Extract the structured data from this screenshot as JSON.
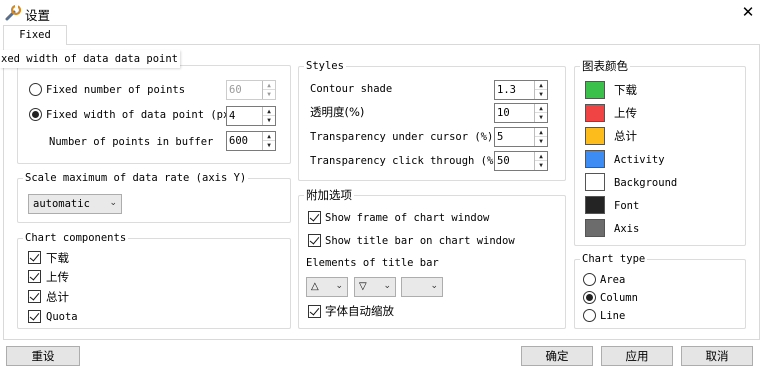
{
  "window": {
    "title": "设置"
  },
  "tabs": {
    "fixed": "Fixed"
  },
  "tooltip": "xed width of data data point",
  "points_group": {
    "fixed_number_label": "Fixed number of points",
    "fixed_number_value": "60",
    "fixed_width_label": "Fixed width of data point (px)",
    "fixed_width_value": "4",
    "buffer_label": "Number of points in buffer",
    "buffer_value": "600"
  },
  "scale_group": {
    "title": "Scale maximum of data rate (axis Y)",
    "value": "automatic"
  },
  "components_group": {
    "title": "Chart components",
    "items": [
      {
        "label": "下载",
        "checked": true
      },
      {
        "label": "上传",
        "checked": true
      },
      {
        "label": "总计",
        "checked": true
      },
      {
        "label": "Quota",
        "checked": true
      }
    ]
  },
  "styles_group": {
    "title": "Styles",
    "contour_label": "Contour shade",
    "contour_value": "1.3",
    "opacity_label": "透明度(%)",
    "opacity_value": "10",
    "cursor_label": "Transparency under cursor (%)",
    "cursor_value": "5",
    "click_label": "Transparency click through (%)",
    "click_value": "50"
  },
  "extra_group": {
    "title": "附加选项",
    "show_frame": "Show frame of chart window",
    "show_title": "Show title bar on chart window",
    "elements_label": "Elements of title bar",
    "auto_scale": "字体自动缩放",
    "combo1_icon": "triangle-up-outline",
    "combo2_icon": "triangle-down-outline"
  },
  "colors_group": {
    "title": "图表颜色",
    "items": [
      {
        "label": "下载",
        "color": "#3cc04c"
      },
      {
        "label": "上传",
        "color": "#f04444"
      },
      {
        "label": "总计",
        "color": "#fcbc1c"
      },
      {
        "label": "Activity",
        "color": "#3c8cf4"
      },
      {
        "label": "Background",
        "color": "#ffffff"
      },
      {
        "label": "Font",
        "color": "#242424"
      },
      {
        "label": "Axis",
        "color": "#6c6c6c"
      }
    ]
  },
  "charttype_group": {
    "title": "Chart type",
    "options": [
      {
        "label": "Area",
        "selected": false
      },
      {
        "label": "Column",
        "selected": true
      },
      {
        "label": "Line",
        "selected": false
      }
    ]
  },
  "footer": {
    "reset": "重设",
    "ok": "确定",
    "apply": "应用",
    "cancel": "取消"
  }
}
